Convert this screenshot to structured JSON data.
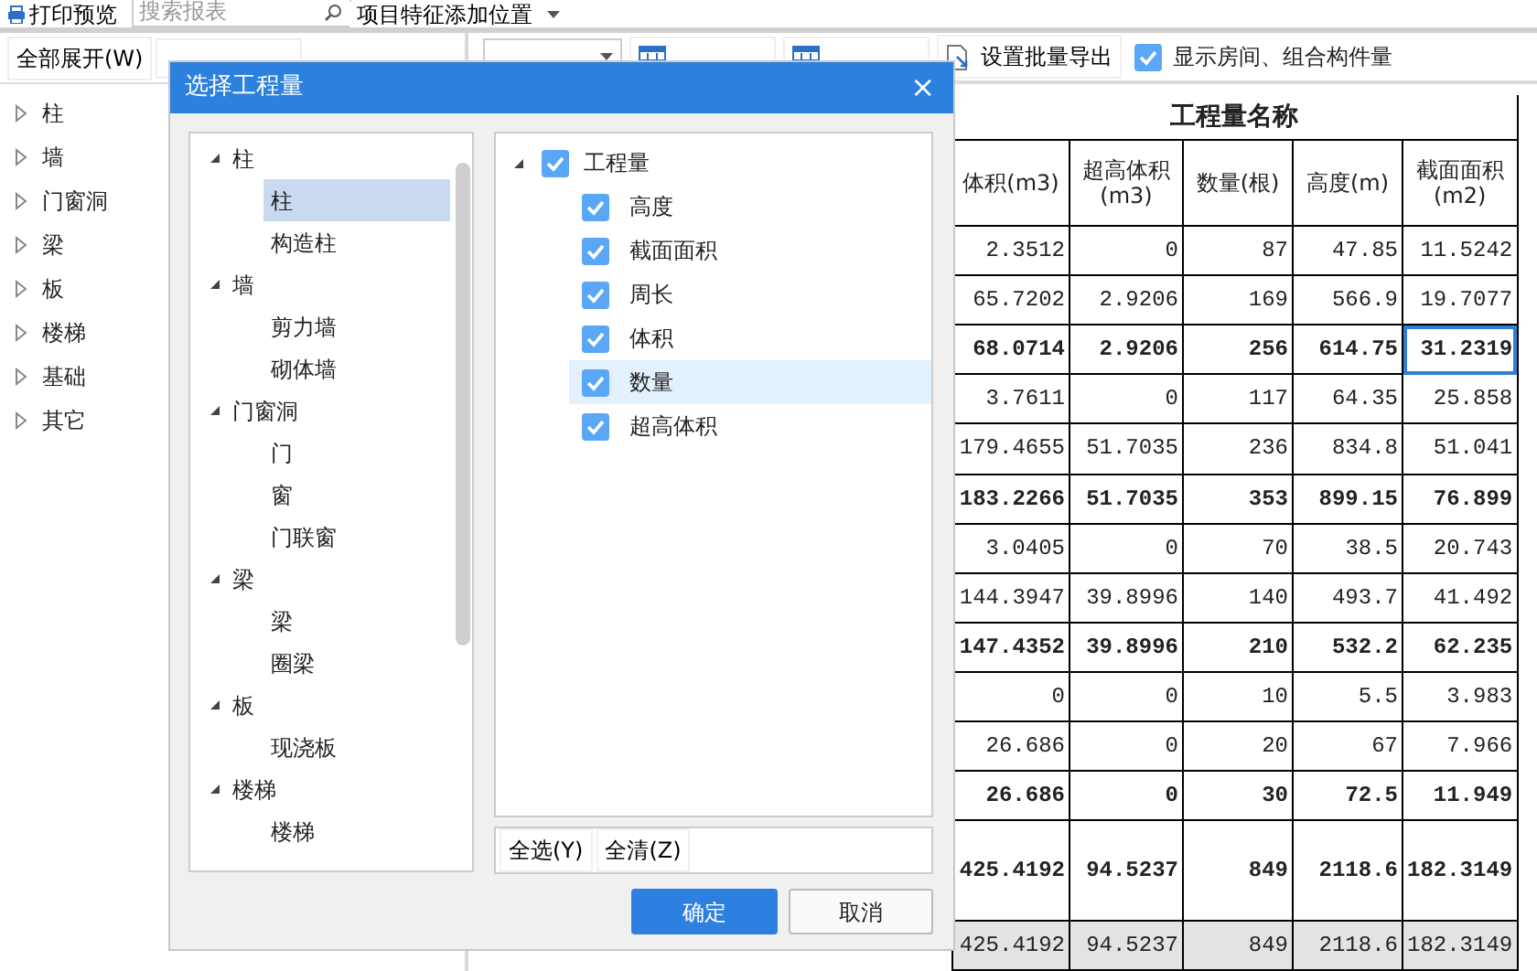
{
  "top_toolbar": {
    "print_preview": "打印预览",
    "search": {
      "placeholder": "搜索报表"
    },
    "position_dropdown": "项目特征添加位置"
  },
  "left_panel": {
    "buttons": [
      "全部展开(W)"
    ],
    "tree": [
      {
        "label": "柱",
        "expanded": false
      },
      {
        "label": "墙",
        "expanded": false
      },
      {
        "label": "门窗洞",
        "expanded": false
      },
      {
        "label": "梁",
        "expanded": false
      },
      {
        "label": "板",
        "expanded": false
      },
      {
        "label": "楼梯",
        "expanded": false
      },
      {
        "label": "基础",
        "expanded": false
      },
      {
        "label": "其它",
        "expanded": false
      }
    ]
  },
  "right_toolbar": {
    "buttons": [
      {
        "kind": "grid"
      },
      {
        "kind": "grid"
      },
      {
        "label": "设置批量导出",
        "kind": "export"
      }
    ],
    "checkbox": {
      "label": "显示房间、组合构件量",
      "checked": true
    }
  },
  "table": {
    "title": "工程量名称",
    "columns": [
      "体积(m3)",
      "超高体积(m3)",
      "数量(根)",
      "高度(m)",
      "截面面积(m2)"
    ],
    "rows": [
      {
        "kind": "item",
        "cells": [
          {
            "text": "2.3512",
            "selected": false
          },
          {
            "text": "0",
            "selected": false
          },
          {
            "text": "87",
            "selected": false
          },
          {
            "text": "47.85",
            "selected": false
          },
          {
            "text": "11.5242",
            "selected": false
          }
        ]
      },
      {
        "kind": "item",
        "cells": [
          {
            "text": "65.7202",
            "selected": false
          },
          {
            "text": "2.9206",
            "selected": false
          },
          {
            "text": "169",
            "selected": false
          },
          {
            "text": "566.9",
            "selected": false
          },
          {
            "text": "19.7077",
            "selected": false
          }
        ]
      },
      {
        "kind": "subtotal",
        "cells": [
          {
            "text": "68.0714",
            "selected": false
          },
          {
            "text": "2.9206",
            "selected": false
          },
          {
            "text": "256",
            "selected": false
          },
          {
            "text": "614.75",
            "selected": false
          },
          {
            "text": "31.2319",
            "selected": true
          }
        ]
      },
      {
        "kind": "item",
        "cells": [
          {
            "text": "3.7611",
            "selected": false
          },
          {
            "text": "0",
            "selected": false
          },
          {
            "text": "117",
            "selected": false
          },
          {
            "text": "64.35",
            "selected": false
          },
          {
            "text": "25.858",
            "selected": false
          }
        ]
      },
      {
        "kind": "item",
        "cells": [
          {
            "text": "179.4655",
            "selected": false
          },
          {
            "text": "51.7035",
            "selected": false
          },
          {
            "text": "236",
            "selected": false
          },
          {
            "text": "834.8",
            "selected": false
          },
          {
            "text": "51.041",
            "selected": false
          }
        ]
      },
      {
        "kind": "subtotal",
        "cells": [
          {
            "text": "183.2266",
            "selected": false
          },
          {
            "text": "51.7035",
            "selected": false
          },
          {
            "text": "353",
            "selected": false
          },
          {
            "text": "899.15",
            "selected": false
          },
          {
            "text": "76.899",
            "selected": false
          }
        ]
      },
      {
        "kind": "item",
        "cells": [
          {
            "text": "3.0405",
            "selected": false
          },
          {
            "text": "0",
            "selected": false
          },
          {
            "text": "70",
            "selected": false
          },
          {
            "text": "38.5",
            "selected": false
          },
          {
            "text": "20.743",
            "selected": false
          }
        ]
      },
      {
        "kind": "item",
        "cells": [
          {
            "text": "144.3947",
            "selected": false
          },
          {
            "text": "39.8996",
            "selected": false
          },
          {
            "text": "140",
            "selected": false
          },
          {
            "text": "493.7",
            "selected": false
          },
          {
            "text": "41.492",
            "selected": false
          }
        ]
      },
      {
        "kind": "subtotal",
        "cells": [
          {
            "text": "147.4352",
            "selected": false
          },
          {
            "text": "39.8996",
            "selected": false
          },
          {
            "text": "210",
            "selected": false
          },
          {
            "text": "532.2",
            "selected": false
          },
          {
            "text": "62.235",
            "selected": false
          }
        ]
      },
      {
        "kind": "item",
        "cells": [
          {
            "text": "0",
            "selected": false
          },
          {
            "text": "0",
            "selected": false
          },
          {
            "text": "10",
            "selected": false
          },
          {
            "text": "5.5",
            "selected": false
          },
          {
            "text": "3.983",
            "selected": false
          }
        ]
      },
      {
        "kind": "item",
        "cells": [
          {
            "text": "26.686",
            "selected": false
          },
          {
            "text": "0",
            "selected": false
          },
          {
            "text": "20",
            "selected": false
          },
          {
            "text": "67",
            "selected": false
          },
          {
            "text": "7.966",
            "selected": false
          }
        ]
      },
      {
        "kind": "subtotal",
        "cells": [
          {
            "text": "26.686",
            "selected": false
          },
          {
            "text": "0",
            "selected": false
          },
          {
            "text": "30",
            "selected": false
          },
          {
            "text": "72.5",
            "selected": false
          },
          {
            "text": "11.949",
            "selected": false
          }
        ]
      },
      {
        "kind": "total",
        "cells": [
          {
            "text": "425.4192",
            "selected": false
          },
          {
            "text": "94.5237",
            "selected": false
          },
          {
            "text": "849",
            "selected": false
          },
          {
            "text": "2118.6",
            "selected": false
          },
          {
            "text": "182.3149",
            "selected": false
          }
        ]
      },
      {
        "kind": "summary",
        "cells": [
          {
            "text": "425.4192",
            "selected": false
          },
          {
            "text": "94.5237",
            "selected": false
          },
          {
            "text": "849",
            "selected": false
          },
          {
            "text": "2118.6",
            "selected": false
          },
          {
            "text": "182.3149",
            "selected": false
          }
        ]
      }
    ]
  },
  "dialog": {
    "title": "选择工程量",
    "close": "×",
    "tree": [
      {
        "label": "柱",
        "expanded": true,
        "children": [
          {
            "label": "柱",
            "selected": true
          },
          {
            "label": "构造柱",
            "selected": false
          }
        ]
      },
      {
        "label": "墙",
        "expanded": true,
        "children": [
          {
            "label": "剪力墙",
            "selected": false
          },
          {
            "label": "砌体墙",
            "selected": false
          }
        ]
      },
      {
        "label": "门窗洞",
        "expanded": true,
        "children": [
          {
            "label": "门",
            "selected": false
          },
          {
            "label": "窗",
            "selected": false
          },
          {
            "label": "门联窗",
            "selected": false
          }
        ]
      },
      {
        "label": "梁",
        "expanded": true,
        "children": [
          {
            "label": "梁",
            "selected": false
          },
          {
            "label": "圈梁",
            "selected": false
          }
        ]
      },
      {
        "label": "板",
        "expanded": true,
        "children": [
          {
            "label": "现浇板",
            "selected": false
          }
        ]
      },
      {
        "label": "楼梯",
        "expanded": true,
        "children": [
          {
            "label": "楼梯",
            "selected": false
          }
        ]
      }
    ],
    "quantities": {
      "label": "工程量",
      "checked": true,
      "expanded": true,
      "children": [
        {
          "label": "高度",
          "checked": true,
          "selected": false
        },
        {
          "label": "截面面积",
          "checked": true,
          "selected": false
        },
        {
          "label": "周长",
          "checked": true,
          "selected": false
        },
        {
          "label": "体积",
          "checked": true,
          "selected": false
        },
        {
          "label": "数量",
          "checked": true,
          "selected": true
        },
        {
          "label": "超高体积",
          "checked": true,
          "selected": false
        }
      ]
    },
    "footer_buttons": [
      "全选(Y)",
      "全清(Z)"
    ],
    "ok": "确定",
    "cancel": "取消"
  }
}
